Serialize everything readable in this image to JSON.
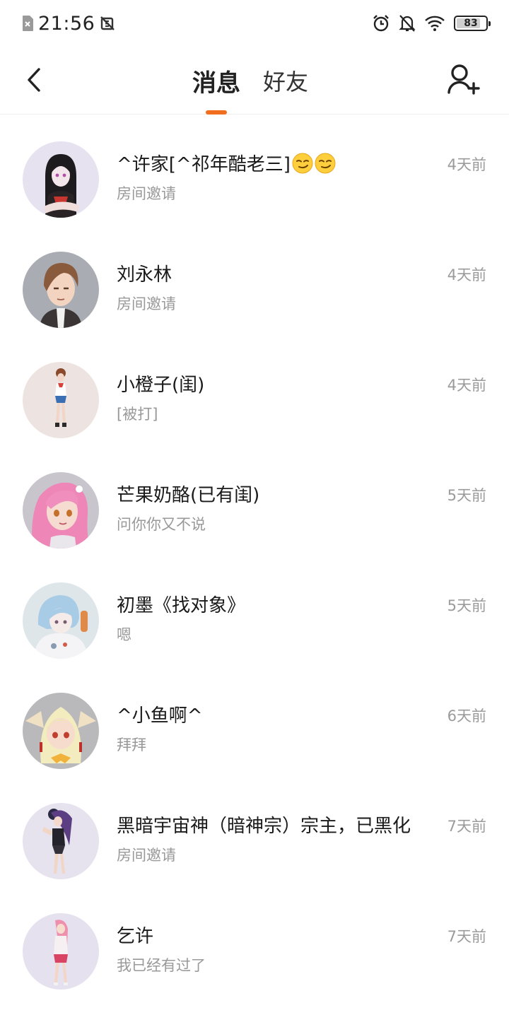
{
  "status_bar": {
    "time": "21:56",
    "battery_level": "83",
    "battery_percent": 83
  },
  "header": {
    "tabs": [
      {
        "label": "消息",
        "active": true
      },
      {
        "label": "好友",
        "active": false
      }
    ]
  },
  "accent_color": "#f06e1d",
  "icons": {
    "back": "chevron-left-icon",
    "add_friend": "add-user-icon",
    "alarm": "alarm-icon",
    "bell_off": "bell-off-icon",
    "wifi": "wifi-icon"
  },
  "conversations": [
    {
      "name": "^许家[^祁年酷老三]",
      "emoji": "smirk-emoji x2",
      "preview": "房间邀请",
      "time": "4天前"
    },
    {
      "name": "刘永林",
      "preview": "房间邀请",
      "time": "4天前"
    },
    {
      "name": "小橙子(闺)",
      "preview": "[被打]",
      "time": "4天前"
    },
    {
      "name": "芒果奶酪(已有闺)",
      "preview": "问你你又不说",
      "time": "5天前"
    },
    {
      "name": "初墨《找对象》",
      "preview": "嗯",
      "time": "5天前"
    },
    {
      "name": "^小鱼啊^",
      "preview": "拜拜",
      "time": "6天前"
    },
    {
      "name": "黑暗宇宙神（暗神宗）宗主，已黑化",
      "preview": "房间邀请",
      "time": "7天前"
    },
    {
      "name": "乞许",
      "preview": "我已经有过了",
      "time": "7天前"
    }
  ]
}
